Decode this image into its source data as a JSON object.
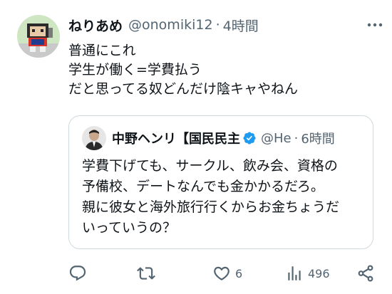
{
  "tweet": {
    "author_name": "ねりあめ",
    "handle": "@onomiki12",
    "separator": "·",
    "time": "4時間",
    "lines": [
      "普通にこれ",
      "学生が働く=学費払う",
      "だと思ってる奴どんだけ陰キャやねん"
    ]
  },
  "quote": {
    "author_name": "中野ヘンリ【国民民主",
    "handle": "@He",
    "separator": "·",
    "time": "6時間",
    "lines": [
      "学費下げても、サークル、飲み会、資格の",
      "予備校、デートなんでも金かかるだろ。",
      "親に彼女と海外旅行行くからお金ちょうだ",
      "いっていうの？"
    ]
  },
  "actions": {
    "reply_count": "",
    "retweet_count": "",
    "like_count": "6",
    "views_count": "496"
  },
  "icons": {
    "more": "more-horizontal-icon",
    "verified": "verified-badge-icon",
    "reply": "reply-icon",
    "retweet": "retweet-icon",
    "like": "heart-icon",
    "views": "views-icon",
    "share": "share-icon"
  },
  "colors": {
    "text": "#0f1419",
    "secondary": "#536471",
    "verified": "#1d9bf0",
    "border": "#cfd9de"
  }
}
